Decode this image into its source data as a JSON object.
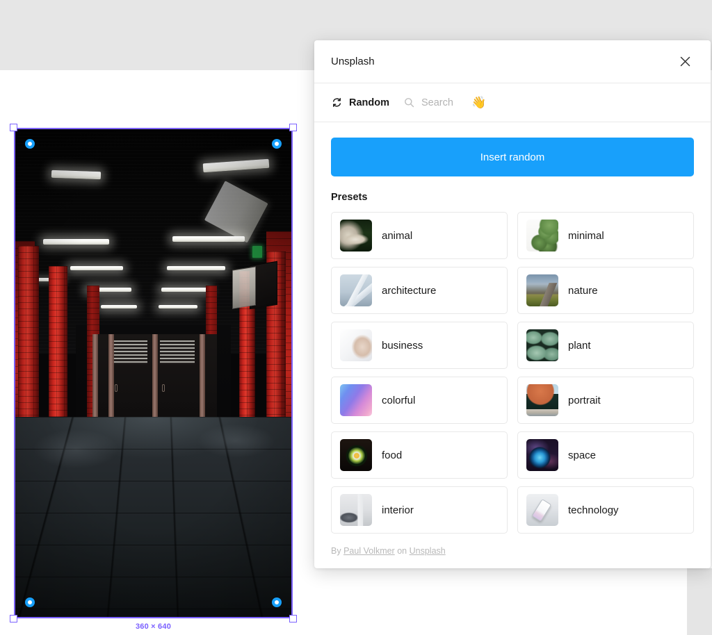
{
  "canvas": {
    "selection": {
      "dimensions_label": "360 × 640",
      "photo_alt": "dark underground subway station with red tiled columns"
    }
  },
  "panel": {
    "title": "Unsplash",
    "close_icon": "close-icon",
    "tabs": [
      {
        "label": "Random",
        "icon": "refresh-icon",
        "active": true
      },
      {
        "label": "Search",
        "icon": "search-icon",
        "active": false
      }
    ],
    "wave_emoji": "👋",
    "insert_button_label": "Insert random",
    "accent_color": "#18a0fb",
    "presets_heading": "Presets",
    "presets": [
      {
        "label": "animal",
        "thumb": "t-animal"
      },
      {
        "label": "minimal",
        "thumb": "t-minimal"
      },
      {
        "label": "architecture",
        "thumb": "t-architecture"
      },
      {
        "label": "nature",
        "thumb": "t-nature"
      },
      {
        "label": "business",
        "thumb": "t-business"
      },
      {
        "label": "plant",
        "thumb": "t-plant"
      },
      {
        "label": "colorful",
        "thumb": "t-colorful"
      },
      {
        "label": "portrait",
        "thumb": "t-portrait"
      },
      {
        "label": "food",
        "thumb": "t-food"
      },
      {
        "label": "space",
        "thumb": "t-space"
      },
      {
        "label": "interior",
        "thumb": "t-interior"
      },
      {
        "label": "technology",
        "thumb": "t-technology"
      }
    ],
    "footer": {
      "by_text": "By",
      "author": "Paul Volkmer",
      "on_text": "on",
      "source": "Unsplash"
    }
  }
}
